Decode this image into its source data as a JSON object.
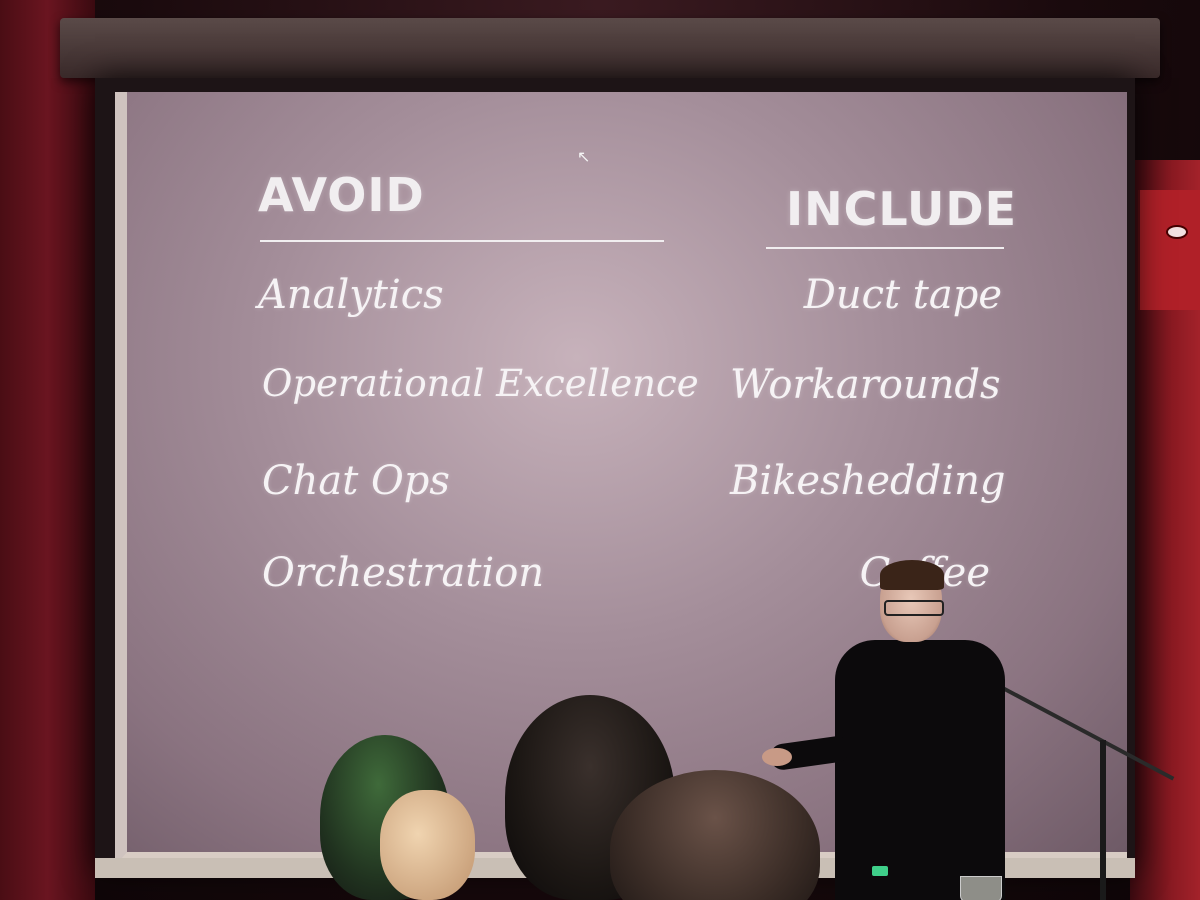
{
  "slide": {
    "left_heading": "AVOID",
    "right_heading": "INCLUDE",
    "avoid_items": [
      "Analytics",
      "Operational Excellence",
      "Chat Ops",
      "Orchestration"
    ],
    "include_items": [
      "Duct tape",
      "Workarounds",
      "Bikeshedding",
      "Coffee"
    ]
  },
  "colors": {
    "slide_text": "#f1eef0",
    "screen": "#a48e9a",
    "wall": "#6a1520"
  },
  "icons": {
    "cursor": "mouse-cursor-icon"
  }
}
